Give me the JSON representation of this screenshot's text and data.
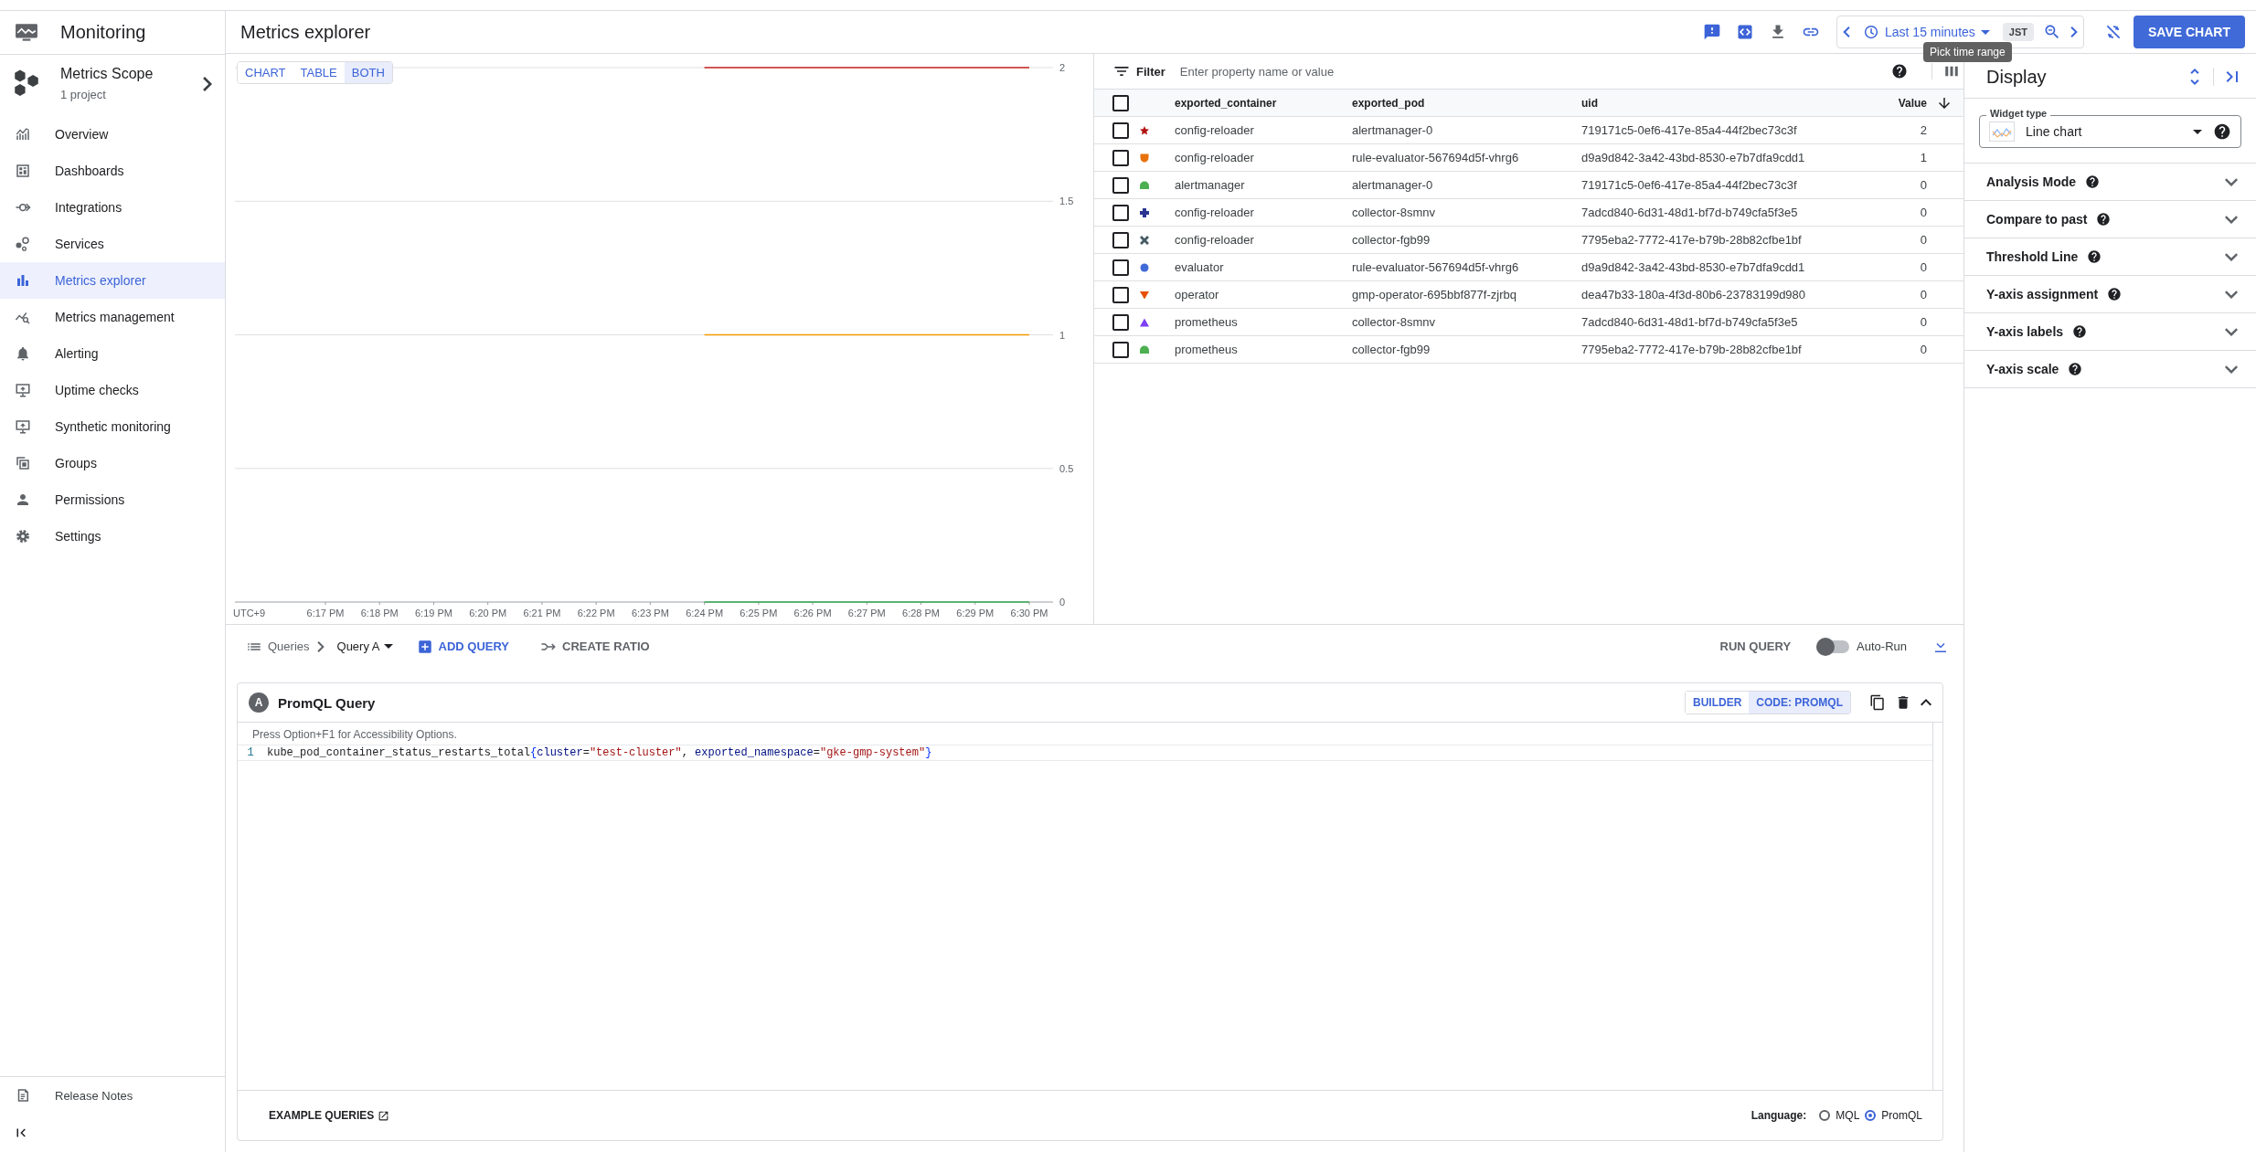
{
  "sidebar": {
    "title": "Monitoring",
    "scope": {
      "title": "Metrics Scope",
      "subtitle": "1 project"
    },
    "items": [
      {
        "label": "Overview",
        "kind": "overview",
        "selected": false
      },
      {
        "label": "Dashboards",
        "kind": "dashboards",
        "selected": false
      },
      {
        "label": "Integrations",
        "kind": "integrations",
        "selected": false
      },
      {
        "label": "Services",
        "kind": "services",
        "selected": false
      },
      {
        "label": "Metrics explorer",
        "kind": "explorer",
        "selected": true
      },
      {
        "label": "Metrics management",
        "kind": "management",
        "selected": false
      },
      {
        "label": "Alerting",
        "kind": "alerting",
        "selected": false
      },
      {
        "label": "Uptime checks",
        "kind": "uptime",
        "selected": false
      },
      {
        "label": "Synthetic monitoring",
        "kind": "synthetic",
        "selected": false
      },
      {
        "label": "Groups",
        "kind": "groups",
        "selected": false
      },
      {
        "label": "Permissions",
        "kind": "permissions",
        "selected": false
      },
      {
        "label": "Settings",
        "kind": "settings",
        "selected": false
      }
    ],
    "footer": {
      "label": "Release Notes"
    }
  },
  "header": {
    "title": "Metrics explorer",
    "time_range": "Last 15 minutes",
    "timezone": "JST",
    "save_button": "SAVE CHART",
    "tooltip": "Pick time range"
  },
  "view_modes": [
    {
      "label": "CHART",
      "selected": false
    },
    {
      "label": "TABLE",
      "selected": false
    },
    {
      "label": "BOTH",
      "selected": true
    }
  ],
  "chart": {
    "timezone_label": "UTC+9",
    "chart_data": {
      "type": "line",
      "categories": [
        "6:17 PM",
        "6:18 PM",
        "6:19 PM",
        "6:20 PM",
        "6:21 PM",
        "6:22 PM",
        "6:23 PM",
        "6:24 PM",
        "6:25 PM",
        "6:26 PM",
        "6:27 PM",
        "6:28 PM",
        "6:29 PM",
        "6:30 PM"
      ],
      "ylim": [
        0,
        2
      ],
      "grid": true,
      "yticks": [
        0,
        0.5,
        1,
        1.5,
        2
      ],
      "series": [
        {
          "color": "#c5221f",
          "values": [
            null,
            null,
            null,
            null,
            null,
            null,
            null,
            2,
            2,
            2,
            2,
            2,
            2,
            2
          ]
        },
        {
          "color": "#f29900",
          "values": [
            null,
            null,
            null,
            null,
            null,
            null,
            null,
            1,
            1,
            1,
            1,
            1,
            1,
            1
          ]
        },
        {
          "color": "#34a853",
          "values": [
            null,
            null,
            null,
            null,
            null,
            null,
            null,
            0,
            0,
            0,
            0,
            0,
            0,
            0
          ]
        }
      ]
    }
  },
  "table": {
    "filter_label": "Filter",
    "filter_placeholder": "Enter property name or value",
    "select_all": {
      "checked": false
    },
    "columns": [
      "exported_container",
      "exported_pod",
      "uid",
      "Value"
    ],
    "rows": [
      {
        "kind": "star",
        "color": "#b31412",
        "checked": false,
        "cells": [
          "config-reloader",
          "alertmanager-0",
          "719171c5-0ef6-417e-85a4-44f2bec73c3f",
          "2"
        ]
      },
      {
        "kind": "shield",
        "color": "#e8710a",
        "checked": false,
        "cells": [
          "config-reloader",
          "rule-evaluator-567694d5f-vhrg6",
          "d9a9d842-3a42-43bd-8530-e7b7dfa9cdd1",
          "1"
        ]
      },
      {
        "kind": "dome",
        "color": "#4caf50",
        "checked": false,
        "cells": [
          "alertmanager",
          "alertmanager-0",
          "719171c5-0ef6-417e-85a4-44f2bec73c3f",
          "0"
        ]
      },
      {
        "kind": "plus",
        "color": "#2a3591",
        "checked": false,
        "cells": [
          "config-reloader",
          "collector-8smnv",
          "7adcd840-6d31-48d1-bf7d-b749cfa5f3e5",
          "0"
        ]
      },
      {
        "kind": "cross",
        "color": "#455a64",
        "checked": false,
        "cells": [
          "config-reloader",
          "collector-fgb99",
          "7795eba2-7772-417e-b79b-28b82cfbe1bf",
          "0"
        ]
      },
      {
        "kind": "circle",
        "color": "#3f6ad8",
        "checked": false,
        "cells": [
          "evaluator",
          "rule-evaluator-567694d5f-vhrg6",
          "d9a9d842-3a42-43bd-8530-e7b7dfa9cdd1",
          "0"
        ]
      },
      {
        "kind": "triangle-down",
        "color": "#e65100",
        "checked": false,
        "cells": [
          "operator",
          "gmp-operator-695bbf877f-zjrbq",
          "dea47b33-180a-4f3d-80b6-23783199d980",
          "0"
        ]
      },
      {
        "kind": "triangle-up",
        "color": "#7e3ff2",
        "checked": false,
        "cells": [
          "prometheus",
          "collector-8smnv",
          "7adcd840-6d31-48d1-bf7d-b749cfa5f3e5",
          "0"
        ]
      },
      {
        "kind": "dome",
        "color": "#4caf50",
        "checked": false,
        "cells": [
          "prometheus",
          "collector-fgb99",
          "7795eba2-7772-417e-b79b-28b82cfbe1bf",
          "0"
        ]
      }
    ]
  },
  "query_bar": {
    "queries_label": "Queries",
    "query_name": "Query A",
    "add_query": "ADD QUERY",
    "create_ratio": "CREATE RATIO",
    "run_query": "RUN QUERY",
    "auto_run": {
      "label": "Auto-Run",
      "on": false
    }
  },
  "query": {
    "badge": "A",
    "title": "PromQL Query",
    "modes": [
      {
        "label": "BUILDER",
        "selected": false
      },
      {
        "label": "CODE: PROMQL",
        "selected": true
      }
    ],
    "hint": "Press Option+F1 for Accessibility Options.",
    "lines": [
      {
        "number": "1",
        "tokens": [
          {
            "text": "kube_pod_container_status_restarts_total",
            "kind": "metric"
          },
          {
            "text": "{",
            "kind": "brace"
          },
          {
            "text": "cluster",
            "kind": "label"
          },
          {
            "text": "=",
            "kind": "op"
          },
          {
            "text": "\"test-cluster\"",
            "kind": "string"
          },
          {
            "text": ", ",
            "kind": "op"
          },
          {
            "text": "exported_namespace",
            "kind": "label"
          },
          {
            "text": "=",
            "kind": "op"
          },
          {
            "text": "\"gke-gmp-system\"",
            "kind": "string"
          },
          {
            "text": "}",
            "kind": "brace"
          }
        ]
      }
    ],
    "example_queries": "EXAMPLE QUERIES",
    "language_label": "Language:",
    "languages": [
      {
        "label": "MQL",
        "selected": false
      },
      {
        "label": "PromQL",
        "selected": true
      }
    ]
  },
  "display": {
    "title": "Display",
    "widget_type": {
      "label": "Widget type",
      "value": "Line chart"
    },
    "sections": [
      {
        "label": "Analysis Mode",
        "expanded": false
      },
      {
        "label": "Compare to past",
        "expanded": false
      },
      {
        "label": "Threshold Line",
        "expanded": false
      },
      {
        "label": "Y-axis assignment",
        "expanded": false
      },
      {
        "label": "Y-axis labels",
        "expanded": false
      },
      {
        "label": "Y-axis scale",
        "expanded": false
      }
    ]
  }
}
